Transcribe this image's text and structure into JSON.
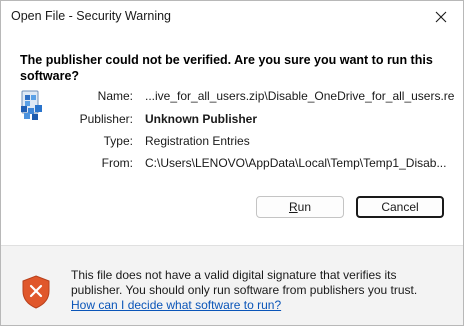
{
  "window": {
    "title": "Open File - Security Warning",
    "close_icon": "close-icon"
  },
  "warning": {
    "headline": "The publisher could not be verified.  Are you sure you want to run this software?"
  },
  "details": {
    "file_icon": "registry-file-icon",
    "name_label": "Name:",
    "name_value": "...ive_for_all_users.zip\\Disable_OneDrive_for_all_users.reg",
    "publisher_label": "Publisher:",
    "publisher_value": "Unknown Publisher",
    "type_label": "Type:",
    "type_value": "Registration Entries",
    "from_label": "From:",
    "from_value": "C:\\Users\\LENOVO\\AppData\\Local\\Temp\\Temp1_Disab..."
  },
  "buttons": {
    "run_mnemonic": "R",
    "run_rest": "un",
    "cancel_label": "Cancel"
  },
  "footer": {
    "shield_icon": "security-shield-icon",
    "message": "This file does not have a valid digital signature that verifies its publisher.  You should only run software from publishers you trust.",
    "help_link": "How can I decide what software to run?"
  },
  "colors": {
    "link": "#0a55b8",
    "shield": "#e0572b",
    "footer_bg": "#f3f3f3"
  }
}
